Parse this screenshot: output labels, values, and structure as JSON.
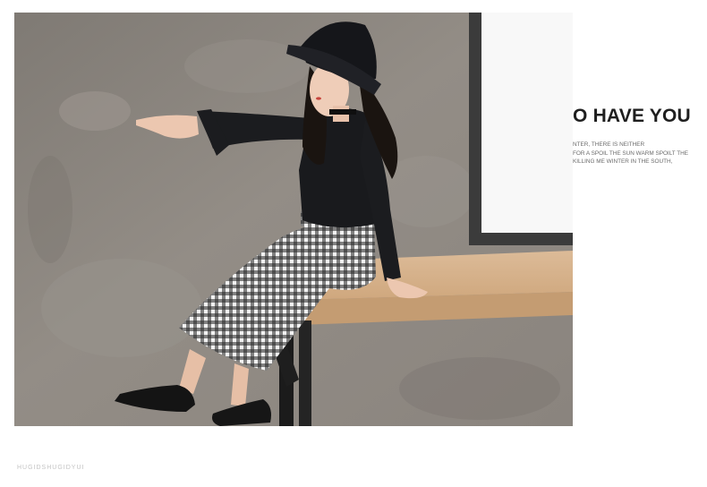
{
  "photo": {
    "alt": "Girl in black hat and long-sleeve top with gingham wide-leg pants sitting on a wooden bench against a grey concrete wall, pointing to the left"
  },
  "copy": {
    "headline": "O HAVE YOU",
    "lines": [
      "NTER, THERE IS NEITHER",
      "FOR A SPOIL THE SUN WARM SPOILT THE",
      "KILLING ME WINTER IN THE SOUTH,"
    ]
  },
  "footer": {
    "caption": "HUGIDSHUGIDYUI"
  },
  "colors": {
    "wall": "#8d8781",
    "bench_top": "#d8b48e",
    "window": "#f4f4f4",
    "text_dark": "#1f1f1f",
    "text_gray": "#6b6b6b"
  }
}
